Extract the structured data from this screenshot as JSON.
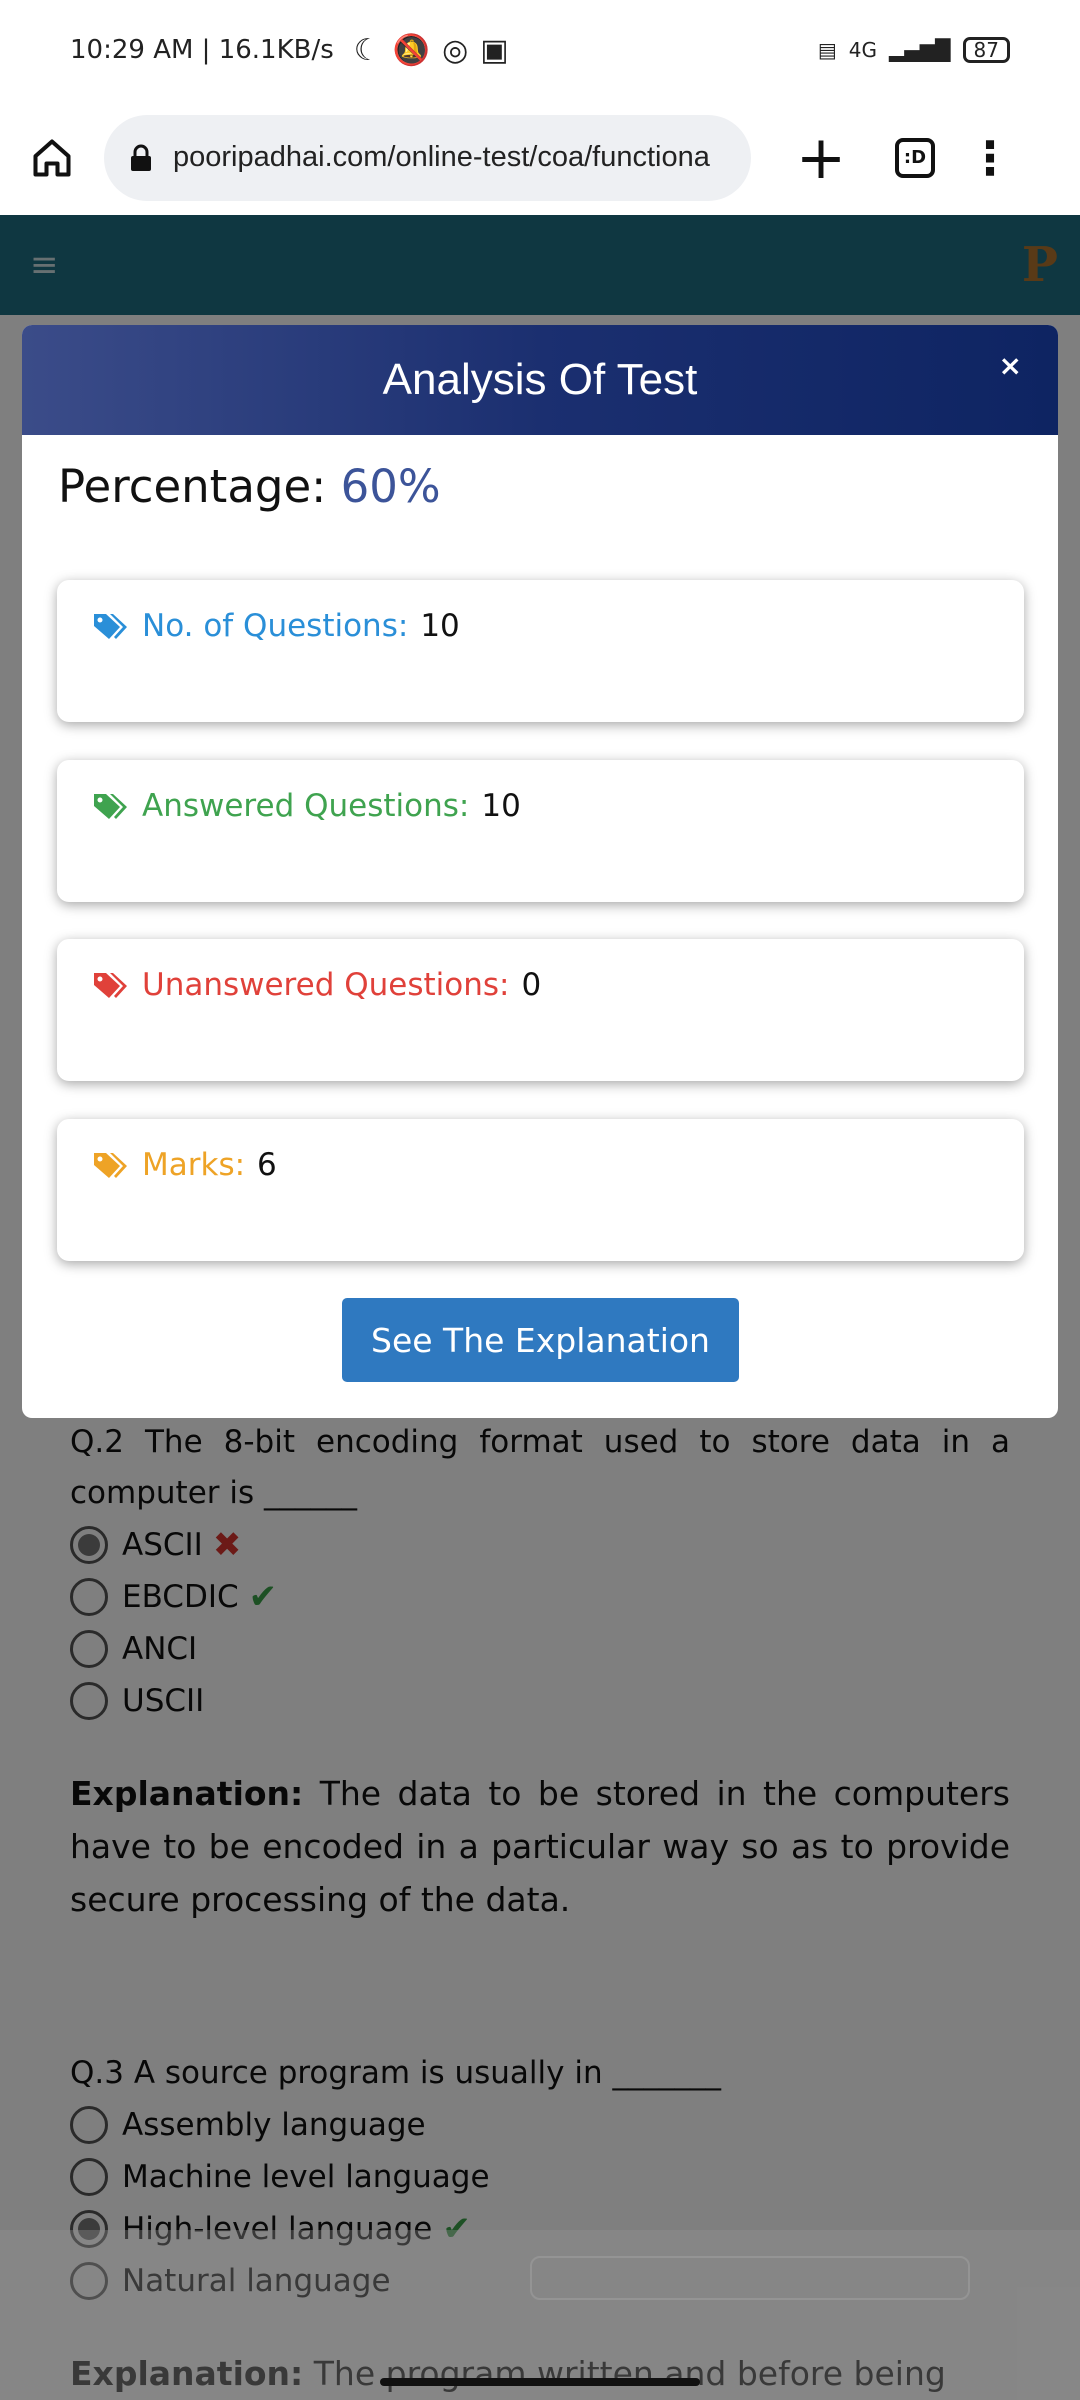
{
  "status_bar": {
    "time_info": "10:29 AM | 16.1KB/s",
    "battery": "87",
    "network": "4G"
  },
  "browser": {
    "url": "pooripadhai.com/online-test/coa/functiona",
    "tabs_label": ":D"
  },
  "site": {
    "logo": "P"
  },
  "modal": {
    "title": "Analysis Of Test",
    "close": "×",
    "percentage_label": "Percentage:",
    "percentage_value": "60%",
    "cards": [
      {
        "label": "No. of Questions:",
        "value": "10",
        "color": "#2a8fd8"
      },
      {
        "label": "Answered Questions:",
        "value": "10",
        "color": "#3fa34f"
      },
      {
        "label": "Unanswered Questions:",
        "value": "0",
        "color": "#e0413a"
      },
      {
        "label": "Marks:",
        "value": "6",
        "color": "#eea326"
      }
    ],
    "button": "See The Explanation"
  },
  "questions": [
    {
      "text": "Q.2 The 8-bit encoding format used to store data in a computer is ______",
      "options": [
        "ASCII",
        "EBCDIC",
        "ANCI",
        "USCII"
      ],
      "explanation_label": "Explanation:",
      "explanation": "The data to be stored in the computers have to be encoded in a particular way so as to provide secure processing of the data."
    },
    {
      "text": "Q.3 A source program is usually in _______",
      "options": [
        "Assembly language",
        "Machine level language",
        "High-level language",
        "Natural language"
      ],
      "explanation_label": "Explanation:",
      "explanation": "The program written and before being"
    }
  ]
}
